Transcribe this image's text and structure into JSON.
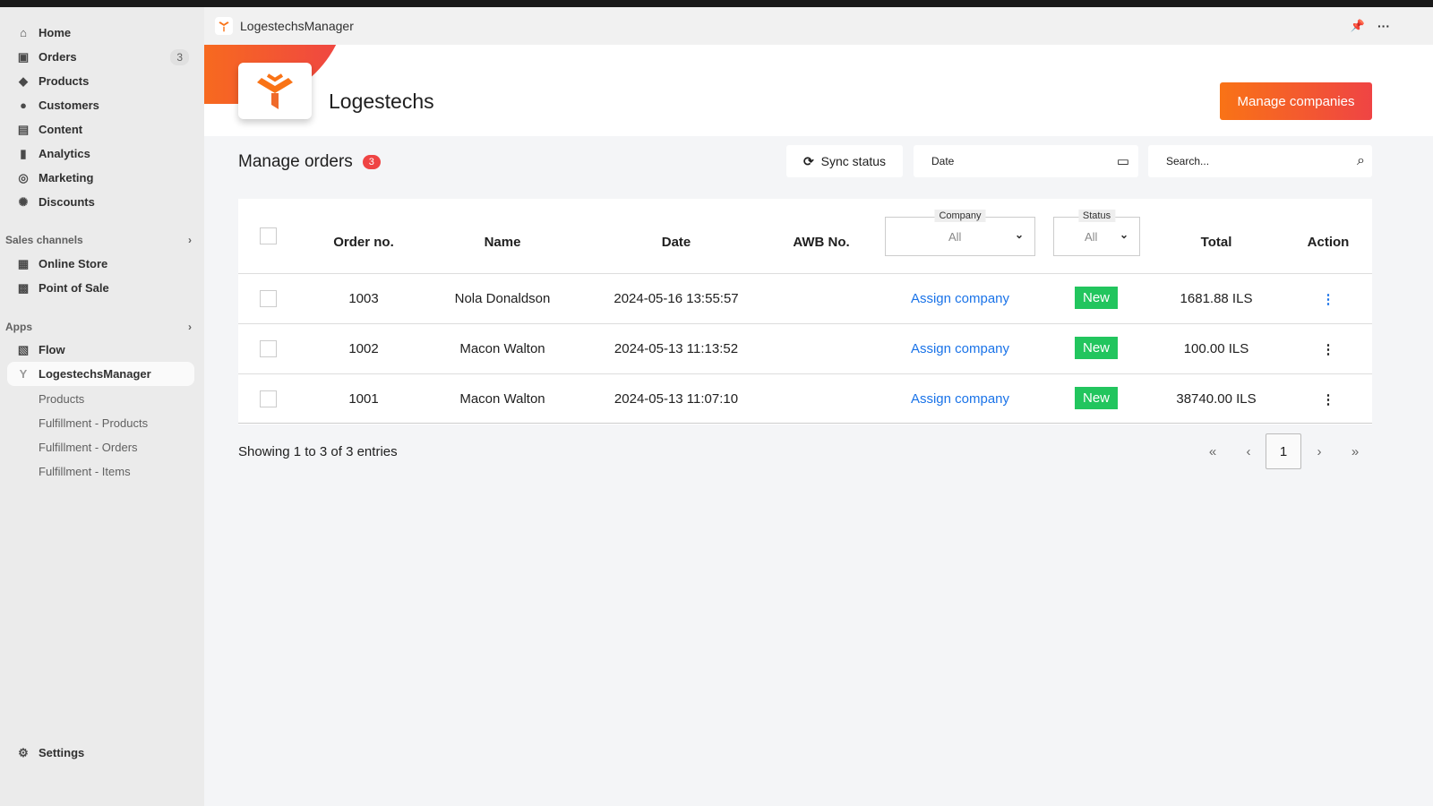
{
  "sidebar": {
    "items": [
      {
        "label": "Home",
        "icon": "home-icon"
      },
      {
        "label": "Orders",
        "icon": "inbox-icon",
        "badge": "3"
      },
      {
        "label": "Products",
        "icon": "tag-icon"
      },
      {
        "label": "Customers",
        "icon": "person-icon"
      },
      {
        "label": "Content",
        "icon": "content-icon"
      },
      {
        "label": "Analytics",
        "icon": "bar-chart-icon"
      },
      {
        "label": "Marketing",
        "icon": "target-icon"
      },
      {
        "label": "Discounts",
        "icon": "discount-icon"
      }
    ],
    "sales_channels": {
      "title": "Sales channels",
      "items": [
        {
          "label": "Online Store"
        },
        {
          "label": "Point of Sale"
        }
      ]
    },
    "apps": {
      "title": "Apps",
      "items": [
        {
          "label": "Flow"
        },
        {
          "label": "LogestechsManager"
        }
      ],
      "sub_items": [
        "Products",
        "Fulfillment - Products",
        "Fulfillment - Orders",
        "Fulfillment - Items"
      ]
    },
    "settings": "Settings"
  },
  "app": {
    "title": "LogestechsManager",
    "brand": "Logestechs",
    "manage_companies": "Manage companies",
    "accent": "#f97316"
  },
  "orders": {
    "title": "Manage orders",
    "count": "3",
    "sync_label": "Sync status",
    "date_placeholder": "Date",
    "search_placeholder": "Search...",
    "columns": {
      "order_no": "Order no.",
      "name": "Name",
      "date": "Date",
      "awb": "AWB No.",
      "company_label": "Company",
      "company_value": "All",
      "status_label": "Status",
      "status_value": "All",
      "total": "Total",
      "action": "Action"
    },
    "rows": [
      {
        "order_no": "1003",
        "name": "Nola Donaldson",
        "date": "2024-05-16 13:55:57",
        "awb": "",
        "company": "Assign company",
        "status": "New",
        "total": "1681.88 ILS"
      },
      {
        "order_no": "1002",
        "name": "Macon Walton",
        "date": "2024-05-13 11:13:52",
        "awb": "",
        "company": "Assign company",
        "status": "New",
        "total": "100.00 ILS"
      },
      {
        "order_no": "1001",
        "name": "Macon Walton",
        "date": "2024-05-13 11:07:10",
        "awb": "",
        "company": "Assign company",
        "status": "New",
        "total": "38740.00 ILS"
      }
    ],
    "footer": "Showing 1 to 3 of 3 entries",
    "pagination": {
      "first": "«",
      "prev": "‹",
      "current": "1",
      "next": "›",
      "last": "»"
    }
  }
}
